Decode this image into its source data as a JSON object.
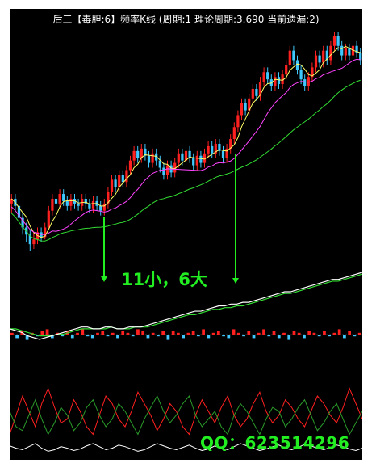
{
  "header": {
    "title": "后三【毒胆:6】频率K线 (周期:1 理论周期:3.690 当前遗漏:2)"
  },
  "annotations": {
    "cycle_text": "11小，6大",
    "qq_text": "QQ：623514296"
  },
  "colors": {
    "background": "#000000",
    "up_candle": "#ff2020",
    "down_candle": "#3fc8ff",
    "ma_short": "#ffff66",
    "ma_mid": "#ff44ff",
    "ma_long": "#33dd33",
    "annotation": "#22ee22"
  },
  "chart_data": [
    {
      "type": "candlestick",
      "panel": "price",
      "candles": [
        [
          48,
          50,
          44,
          52
        ],
        [
          50,
          47,
          45,
          52
        ],
        [
          47,
          42,
          40,
          49
        ],
        [
          42,
          38,
          35,
          44
        ],
        [
          38,
          35,
          32,
          40
        ],
        [
          35,
          31,
          28,
          37
        ],
        [
          31,
          33,
          29,
          36
        ],
        [
          33,
          36,
          31,
          38
        ],
        [
          36,
          34,
          32,
          38
        ],
        [
          34,
          38,
          33,
          40
        ],
        [
          38,
          45,
          37,
          47
        ],
        [
          45,
          50,
          43,
          52
        ],
        [
          50,
          48,
          46,
          53
        ],
        [
          48,
          52,
          46,
          54
        ],
        [
          52,
          49,
          47,
          54
        ],
        [
          49,
          47,
          45,
          51
        ],
        [
          47,
          50,
          45,
          52
        ],
        [
          50,
          48,
          46,
          52
        ],
        [
          48,
          47,
          45,
          50
        ],
        [
          47,
          50,
          45,
          52
        ],
        [
          50,
          48,
          46,
          52
        ],
        [
          48,
          46,
          44,
          50
        ],
        [
          46,
          49,
          44,
          51
        ],
        [
          49,
          47,
          45,
          51
        ],
        [
          47,
          45,
          43,
          49
        ],
        [
          45,
          48,
          43,
          50
        ],
        [
          48,
          53,
          46,
          55
        ],
        [
          53,
          58,
          51,
          60
        ],
        [
          58,
          55,
          53,
          60
        ],
        [
          55,
          60,
          53,
          62
        ],
        [
          60,
          57,
          55,
          62
        ],
        [
          57,
          62,
          55,
          64
        ],
        [
          62,
          66,
          60,
          68
        ],
        [
          66,
          70,
          64,
          72
        ],
        [
          70,
          67,
          65,
          72
        ],
        [
          67,
          71,
          65,
          73
        ],
        [
          71,
          68,
          66,
          73
        ],
        [
          68,
          65,
          63,
          70
        ],
        [
          65,
          69,
          63,
          71
        ],
        [
          69,
          66,
          64,
          71
        ],
        [
          66,
          63,
          61,
          68
        ],
        [
          63,
          60,
          58,
          65
        ],
        [
          60,
          64,
          58,
          66
        ],
        [
          64,
          61,
          59,
          66
        ],
        [
          61,
          65,
          59,
          67
        ],
        [
          65,
          69,
          63,
          71
        ],
        [
          69,
          66,
          64,
          71
        ],
        [
          66,
          70,
          64,
          72
        ],
        [
          70,
          67,
          65,
          72
        ],
        [
          67,
          64,
          62,
          69
        ],
        [
          64,
          68,
          62,
          70
        ],
        [
          68,
          65,
          63,
          70
        ],
        [
          65,
          69,
          63,
          71
        ],
        [
          69,
          72,
          67,
          74
        ],
        [
          72,
          69,
          67,
          74
        ],
        [
          69,
          73,
          67,
          75
        ],
        [
          73,
          70,
          68,
          75
        ],
        [
          70,
          67,
          65,
          72
        ],
        [
          67,
          71,
          65,
          73
        ],
        [
          71,
          75,
          69,
          77
        ],
        [
          75,
          80,
          73,
          82
        ],
        [
          80,
          85,
          78,
          87
        ],
        [
          85,
          90,
          83,
          92
        ],
        [
          90,
          87,
          85,
          92
        ],
        [
          87,
          92,
          85,
          94
        ],
        [
          92,
          96,
          90,
          98
        ],
        [
          96,
          93,
          91,
          98
        ],
        [
          93,
          99,
          91,
          101
        ],
        [
          99,
          103,
          97,
          105
        ],
        [
          103,
          100,
          98,
          105
        ],
        [
          100,
          97,
          95,
          102
        ],
        [
          97,
          101,
          95,
          103
        ],
        [
          101,
          98,
          96,
          103
        ],
        [
          98,
          102,
          96,
          104
        ],
        [
          102,
          106,
          100,
          108
        ],
        [
          106,
          112,
          104,
          114
        ],
        [
          112,
          108,
          106,
          114
        ],
        [
          108,
          104,
          102,
          110
        ],
        [
          104,
          100,
          98,
          106
        ],
        [
          100,
          97,
          95,
          102
        ],
        [
          97,
          101,
          95,
          103
        ],
        [
          101,
          105,
          99,
          107
        ],
        [
          105,
          110,
          103,
          112
        ],
        [
          110,
          107,
          105,
          112
        ],
        [
          107,
          112,
          105,
          114
        ],
        [
          112,
          108,
          106,
          114
        ],
        [
          108,
          114,
          106,
          116
        ],
        [
          114,
          118,
          112,
          120
        ],
        [
          118,
          114,
          112,
          120
        ],
        [
          114,
          110,
          108,
          116
        ],
        [
          110,
          113,
          108,
          115
        ],
        [
          113,
          110,
          108,
          115
        ],
        [
          110,
          114,
          108,
          116
        ],
        [
          114,
          111,
          109,
          116
        ],
        [
          111,
          108,
          106,
          113
        ]
      ]
    },
    {
      "type": "line",
      "panel": "indicator",
      "series": [
        {
          "values": [
            0,
            -1,
            -2,
            -4,
            -5,
            -6,
            -5,
            -4,
            -3,
            -2,
            -1,
            0,
            1,
            1,
            0,
            0,
            1,
            1,
            0,
            0,
            1,
            1,
            1,
            2,
            3,
            4,
            5,
            6,
            7,
            8,
            9,
            10,
            10,
            11,
            12,
            13,
            13,
            14,
            14,
            15,
            15,
            16,
            17,
            18,
            19,
            20,
            21,
            21,
            22,
            23,
            24,
            25,
            26,
            27,
            28,
            28,
            29,
            30,
            31,
            32
          ]
        },
        {
          "values": [
            0,
            0,
            -1,
            -2,
            -3,
            -4,
            -4,
            -4,
            -3,
            -3,
            -2,
            -1,
            0,
            0,
            0,
            0,
            0,
            1,
            0,
            0,
            0,
            1,
            1,
            1,
            2,
            3,
            4,
            5,
            6,
            7,
            8,
            8,
            9,
            10,
            11,
            11,
            12,
            12,
            13,
            13,
            14,
            15,
            16,
            17,
            18,
            19,
            20,
            20,
            21,
            22,
            23,
            24,
            25,
            26,
            27,
            27,
            28,
            29,
            30,
            31
          ]
        }
      ],
      "bars": [
        1,
        -2,
        2,
        -3,
        1,
        -1,
        2,
        3,
        -2,
        1,
        -1,
        2,
        -2,
        1,
        3,
        -1,
        -2,
        1,
        2,
        -1,
        1,
        -2,
        2,
        1,
        -1,
        3,
        2,
        -2,
        1,
        -1,
        2,
        -3,
        2,
        1,
        -2,
        1,
        2,
        -1,
        3,
        -2,
        1,
        2,
        -1,
        -2,
        3,
        1,
        -1,
        2,
        -2,
        1,
        3,
        -1,
        2,
        -2,
        1,
        -3,
        2,
        1,
        -2,
        2,
        1,
        -1,
        2,
        -1,
        1,
        3,
        -2,
        2,
        -1,
        1
      ]
    },
    {
      "type": "line",
      "panel": "oscillator",
      "series": [
        {
          "values": [
            30,
            55,
            80,
            60,
            40,
            70,
            90,
            65,
            45,
            50,
            75,
            60,
            40,
            30,
            55,
            80,
            70,
            50,
            40,
            60,
            85,
            70,
            55,
            35,
            50,
            70,
            60,
            40,
            30,
            55,
            75,
            60,
            45,
            65,
            80,
            55,
            40,
            50,
            70,
            85,
            60,
            45,
            55,
            75,
            65,
            50,
            40,
            60,
            80,
            70,
            55,
            45,
            65,
            90,
            70,
            50
          ]
        },
        {
          "values": [
            60,
            40,
            35,
            55,
            75,
            50,
            30,
            45,
            65,
            55,
            35,
            45,
            65,
            75,
            55,
            40,
            50,
            70,
            60,
            45,
            30,
            50,
            65,
            80,
            60,
            45,
            55,
            70,
            80,
            55,
            40,
            50,
            60,
            40,
            30,
            55,
            70,
            60,
            45,
            30,
            50,
            65,
            60,
            40,
            50,
            65,
            75,
            55,
            35,
            45,
            60,
            70,
            50,
            30,
            45,
            60
          ]
        },
        {
          "values": [
            15,
            12,
            10,
            14,
            18,
            12,
            8,
            10,
            14,
            12,
            9,
            11,
            15,
            18,
            14,
            10,
            12,
            16,
            14,
            11,
            8,
            10,
            14,
            18,
            15,
            12,
            10,
            13,
            16,
            12,
            9,
            11,
            15,
            12,
            10,
            14,
            18,
            15,
            12,
            9,
            11,
            14,
            16,
            12,
            10,
            13,
            17,
            15,
            12,
            10,
            13,
            16,
            14,
            11,
            9,
            12
          ]
        }
      ]
    }
  ]
}
